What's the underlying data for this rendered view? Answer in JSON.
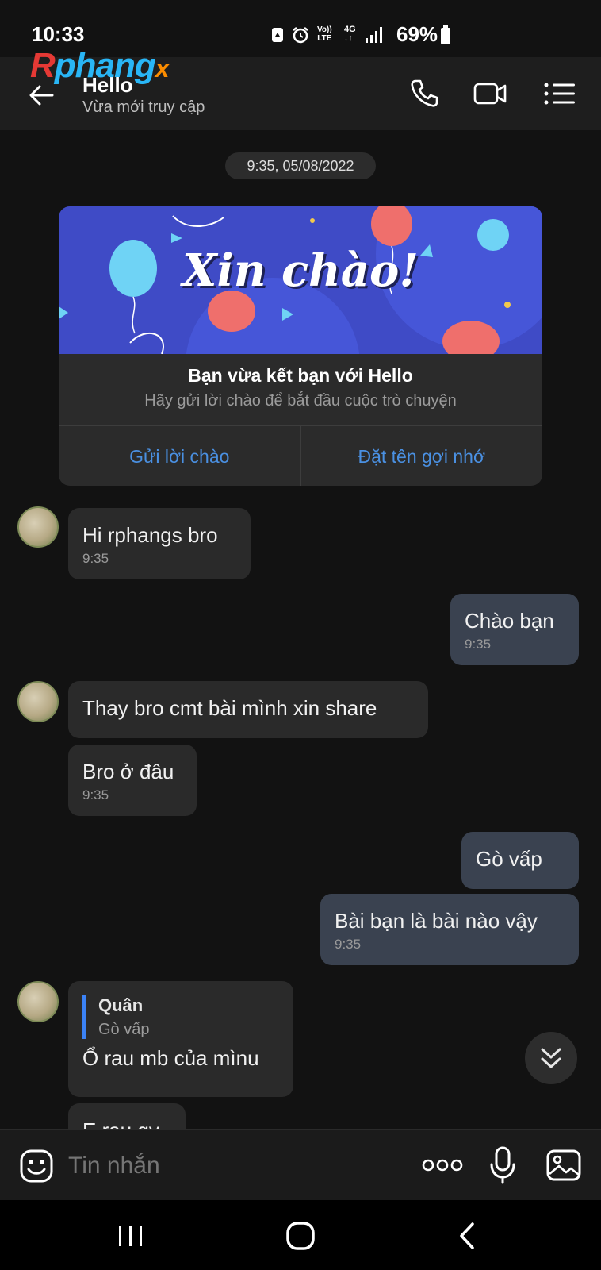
{
  "status_bar": {
    "time": "10:33",
    "network_top": "Vo))",
    "network_bottom": "LTE",
    "data_type": "4G",
    "battery": "69%"
  },
  "watermark": {
    "part1": "R",
    "part2": "phang",
    "part3": "x"
  },
  "header": {
    "contact_name": "Hello",
    "contact_status": "Vừa mới truy cập",
    "icons": [
      "back-arrow-icon",
      "phone-icon",
      "video-camera-icon",
      "menu-list-icon"
    ]
  },
  "chat": {
    "date_separator": "9:35, 05/08/2022",
    "friend_card": {
      "banner_text": "Xin chào!",
      "title": "Bạn vừa kết bạn với Hello",
      "subtitle": "Hãy gửi lời chào để bắt đầu cuộc trò chuyện",
      "actions": [
        "Gửi lời chào",
        "Đặt tên gợi nhớ"
      ]
    },
    "messages": [
      {
        "side": "in",
        "text": "Hi rphangs bro",
        "time": "9:35"
      },
      {
        "side": "out",
        "text": "Chào bạn",
        "time": "9:35"
      },
      {
        "side": "in",
        "text": "Thay bro cmt bài mình xin share",
        "time": ""
      },
      {
        "side": "in",
        "text": "Bro ở đâu",
        "time": "9:35"
      },
      {
        "side": "out",
        "text": "Gò vấp",
        "time": ""
      },
      {
        "side": "out",
        "text": "Bài bạn là bài nào vậy",
        "time": "9:35"
      },
      {
        "side": "in",
        "reply_name": "Quân",
        "reply_text": "Gò vấp",
        "text": "Ổ rau mb của mìnu",
        "time": ""
      },
      {
        "side": "in",
        "text": "E rau gy",
        "time": ""
      }
    ]
  },
  "input_bar": {
    "placeholder": "Tin nhắn",
    "icons": [
      "emoji-icon",
      "more-icon",
      "microphone-icon",
      "image-icon"
    ]
  },
  "nav_bar": {
    "icons": [
      "recent-apps-icon",
      "home-icon",
      "back-icon"
    ]
  },
  "colors": {
    "background": "#121212",
    "accent": "#4a90e2",
    "bubble_in": "#2a2a2a",
    "bubble_out": "#3a4250"
  }
}
